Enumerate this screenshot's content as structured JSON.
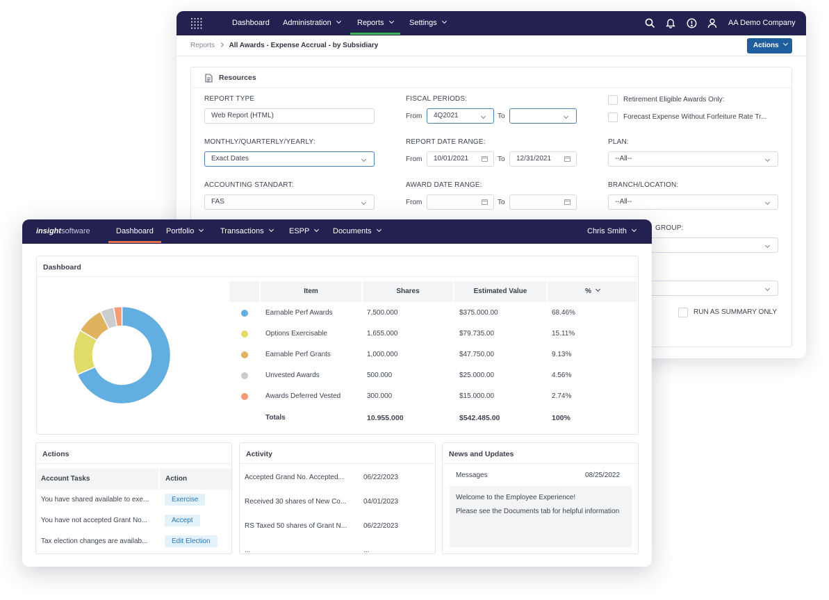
{
  "back": {
    "nav": {
      "items": [
        "Dashboard",
        "Administration",
        "Reports",
        "Settings"
      ],
      "company": "AA Demo Company"
    },
    "breadcrumb": {
      "root": "Reports",
      "current": "All Awards  - Expense Accrual - by Subsidiary"
    },
    "actions_label": "Actions",
    "resources_title": "Resources",
    "form": {
      "report_type_label": "REPORT TYPE",
      "report_type_value": "Web Report (HTML)",
      "mqy_label": "MONTHLY/QUARTERLY/YEARLY:",
      "mqy_value": "Exact Dates",
      "acct_label": "ACCOUNTING STANDART:",
      "acct_value": "FAS",
      "fiscal_label": "FISCAL PERIODS:",
      "from_label": "From",
      "to_label": "To",
      "fiscal_from": "4Q2021",
      "report_range_label": "REPORT DATE RANGE:",
      "report_from": "10/01/2021",
      "report_to": "12/31/2021",
      "award_range_label": "AWARD DATE RANGE:",
      "retire_label": "Retirement Eligible Awards Only:",
      "forecast_label": "Forecast Expense Without Forfeiture Rate Tr...",
      "plan_label": "PLAN:",
      "plan_value": "--All--",
      "branch_label": "BRANCH/LOCATION:",
      "branch_value": "--All--",
      "group_label": "GROUP:",
      "summary_label": "RUN AS SUMMARY ONLY"
    }
  },
  "front": {
    "logo": {
      "a": "insight",
      "b": "software"
    },
    "nav": {
      "items": [
        "Dashboard",
        "Portfolio",
        "Transactions",
        "ESPP",
        "Documents"
      ],
      "user": "Chris Smith"
    },
    "dashboard": {
      "title": "Dashboard",
      "headers": [
        "Item",
        "Shares",
        "Estimated Value",
        "%"
      ],
      "rows": [
        {
          "item": "Earnable Perf Awards",
          "shares": "7,500.000",
          "value": "$375.000.00",
          "pct": "68.46%",
          "color": "#62aee0"
        },
        {
          "item": "Options Exercisable",
          "shares": "1,655.000",
          "value": "$79.735.00",
          "pct": "15.11%",
          "color": "#e1dc6a"
        },
        {
          "item": "Earnable Perf Grants",
          "shares": "1,000.000",
          "value": "$47.750.00",
          "pct": "9.13%",
          "color": "#dfb25f"
        },
        {
          "item": "Unvested Awards",
          "shares": "500.000",
          "value": "$25.000.00",
          "pct": "4.56%",
          "color": "#cccccc"
        },
        {
          "item": "Awards  Deferred Vested",
          "shares": "300.000",
          "value": "$15.000.00",
          "pct": "2.74%",
          "color": "#f59a73"
        }
      ],
      "totals": {
        "label": "Totals",
        "shares": "10.955.000",
        "value": "$542.485.00",
        "pct": "100%"
      }
    },
    "chart_data": {
      "type": "pie",
      "categories": [
        "Earnable Perf Awards",
        "Options Exercisable",
        "Earnable Perf Grants",
        "Unvested Awards",
        "Awards  Deferred Vested"
      ],
      "values": [
        68.46,
        15.11,
        9.13,
        4.56,
        2.74
      ],
      "colors": [
        "#62aee0",
        "#e1dc6a",
        "#dfb25f",
        "#cccccc",
        "#f59a73"
      ],
      "donut": true
    },
    "actions": {
      "title": "Actions",
      "headers": [
        "Account Tasks",
        "Action"
      ],
      "rows": [
        {
          "task": "You have shared available to exe...",
          "action": "Exercise"
        },
        {
          "task": "You have not accepted Grant No...",
          "action": "Accept"
        },
        {
          "task": "Tax election changes are availab...",
          "action": "Edit Election"
        }
      ]
    },
    "activity": {
      "title": "Activity",
      "rows": [
        {
          "text": "Accepted Grand No. Accepted...",
          "date": "06/22/2023"
        },
        {
          "text": "Received 30 shares of New Co...",
          "date": "04/01/2023"
        },
        {
          "text": "RS Taxed 50 shares of Grant N...",
          "date": "06/22/2023"
        },
        {
          "text": "...",
          "date": "..."
        }
      ]
    },
    "news": {
      "title": "News and Updates",
      "messages_label": "Messages",
      "date": "08/25/2022",
      "line1": "Welcome to the Employee Experience!",
      "line2": "Please see the Documents tab for helpful information"
    }
  }
}
